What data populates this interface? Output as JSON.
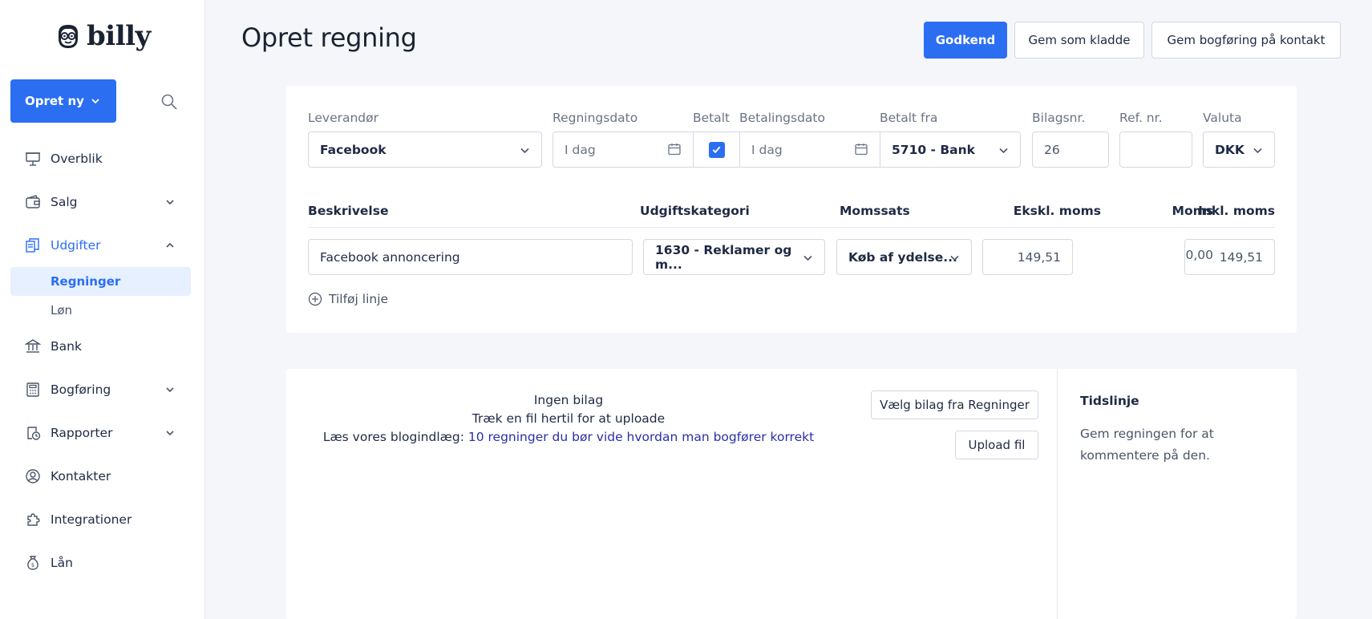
{
  "sidebar": {
    "logo_text": "billy",
    "create_label": "Opret ny",
    "items": [
      {
        "label": "Overblik"
      },
      {
        "label": "Salg"
      },
      {
        "label": "Udgifter"
      },
      {
        "label": "Regninger"
      },
      {
        "label": "Løn"
      },
      {
        "label": "Bank"
      },
      {
        "label": "Bogføring"
      },
      {
        "label": "Rapporter"
      },
      {
        "label": "Kontakter"
      },
      {
        "label": "Integrationer"
      },
      {
        "label": "Lån"
      }
    ]
  },
  "header": {
    "title": "Opret regning",
    "approve_label": "Godkend",
    "draft_label": "Gem som kladde",
    "save_contact_label": "Gem bogføring på kontakt"
  },
  "bill": {
    "labels": {
      "supplier": "Leverandør",
      "bill_date": "Regningsdato",
      "paid": "Betalt",
      "payment_date": "Betalingsdato",
      "paid_from": "Betalt fra",
      "voucher_no": "Bilagsnr.",
      "ref_no": "Ref. nr.",
      "currency": "Valuta"
    },
    "values": {
      "supplier": "Facebook",
      "bill_date": "I dag",
      "paid": true,
      "payment_date": "I dag",
      "paid_from": "5710 - Bank",
      "voucher_no": "26",
      "ref_no": "",
      "currency": "DKK"
    },
    "columns": {
      "description": "Beskrivelse",
      "category": "Udgiftskategori",
      "vat_rate": "Momssats",
      "excl_vat": "Ekskl. moms",
      "vat": "Moms",
      "incl_vat": "Inkl. moms"
    },
    "lines": [
      {
        "description": "Facebook annoncering",
        "category": "1630 - Reklamer og m...",
        "vat_rate": "Køb af ydelse...",
        "excl_vat": "149,51",
        "vat": "0,00",
        "incl_vat": "149,51"
      }
    ],
    "add_line_label": "Tilføj linje"
  },
  "attachments": {
    "none_text": "Ingen bilag",
    "drag_text": "Træk en fil hertil for at uploade",
    "blog_prefix": "Læs vores blogindlæg: ",
    "blog_link": "10 regninger du bør vide hvordan man bogfører korrekt",
    "choose_label": "Vælg bilag fra Regninger",
    "upload_label": "Upload fil"
  },
  "timeline": {
    "title": "Tidslinje",
    "text": "Gem regningen for at kommentere på den."
  },
  "colors": {
    "accent": "#2b6ef2",
    "link": "#2a2fa8",
    "background": "#f4f6fa"
  }
}
